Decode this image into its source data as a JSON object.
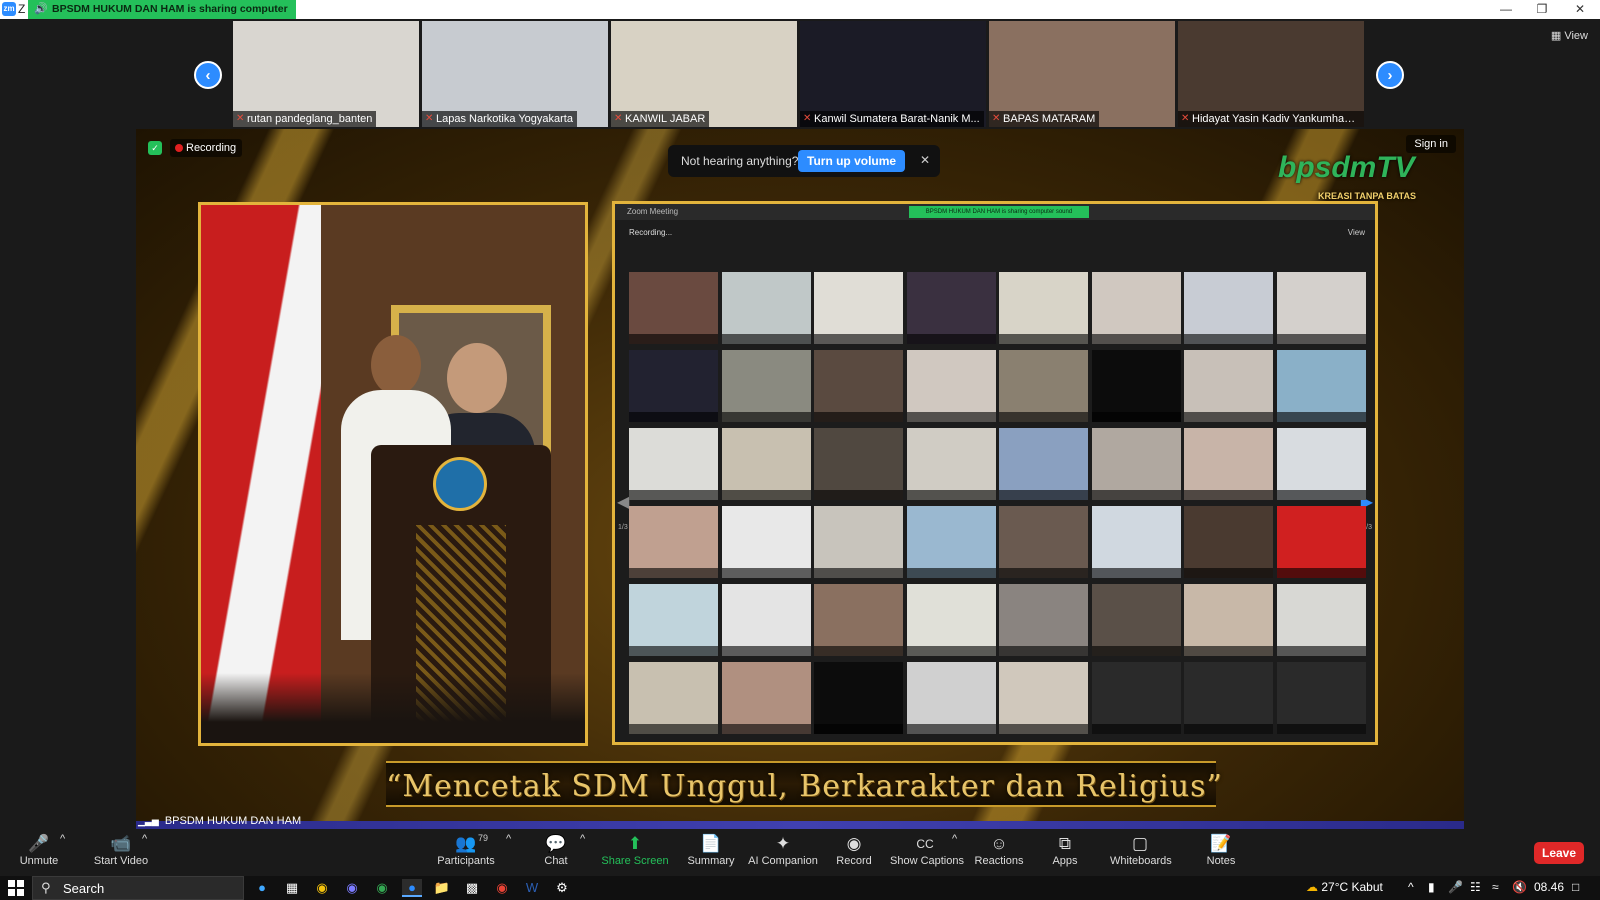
{
  "app": {
    "title_letter": "Z",
    "share_banner": "BPSDM HUKUM DAN HAM is sharing computer sound",
    "view_label": "View"
  },
  "gallery": [
    {
      "name": "rutan pandeglang_banten",
      "bg": "#d9d6d0"
    },
    {
      "name": "Lapas Narkotika Yogyakarta",
      "bg": "#c7cbd0"
    },
    {
      "name": "KANWIL JABAR",
      "bg": "#d8d2c4"
    },
    {
      "name": "Kanwil Sumatera Barat-Nanik M...",
      "bg": "#1b1b26"
    },
    {
      "name": "BAPAS MATARAM",
      "bg": "#8a7060"
    },
    {
      "name": "Hidayat Yasin Kadiv Yankumham ...",
      "bg": "#4a3a30"
    }
  ],
  "share": {
    "recording_label": "Recording",
    "sign_in": "Sign in",
    "toast_msg": "Not hearing anything?",
    "toast_btn": "Turn up volume",
    "logo_text": "bpsdmTV",
    "logo_sub": "KREASI TANPA BATAS",
    "slogan": "“Mencetak SDM Unggul, Berkarakter dan Religius”",
    "presenter_name": "BPSDM HUKUM DAN HAM",
    "nested_title": "Zoom Meeting",
    "nested_banner": "BPSDM HUKUM DAN HAM is sharing computer sound",
    "nested_rec": "Recording...",
    "nested_view": "View",
    "nested_page_left": "1/3",
    "nested_page_right": "1/3",
    "nested_cells": [
      "#6a4a40",
      "#c0c8c8",
      "#e0ddd6",
      "#3a3040",
      "#d8d4c8",
      "#d0c8c0",
      "#c8ccd4",
      "#d4d0cc",
      "#222230",
      "#8a8a80",
      "#5a4a40",
      "#d0c8c0",
      "#8a8070",
      "#0c0c0c",
      "#c8c0b8",
      "#8ab0c8",
      "#dcdcd8",
      "#c8c0b0",
      "#504840",
      "#d0ccc4",
      "#8aa0c0",
      "#b0a8a0",
      "#c8b4a8",
      "#d8dce0",
      "#c0a090",
      "#e8e8e8",
      "#c8c4bc",
      "#9ab8d0",
      "#6a5a50",
      "#d0d8e0",
      "#4a3a30",
      "#d02020",
      "#c0d4dc",
      "#e4e4e4",
      "#8a7060",
      "#e0e0d8",
      "#8a8480",
      "#5a5048",
      "#c8b8a8",
      "#d8d8d4",
      "#c8c0b0",
      "#b09080",
      "#0c0c0c",
      "#d0d0d0",
      "#d0c8bc",
      "#2a2a2a",
      "#2a2a2a",
      "#2a2a2a"
    ]
  },
  "controls": {
    "unmute": "Unmute",
    "start_video": "Start Video",
    "participants": "Participants",
    "participants_count": "79",
    "chat": "Chat",
    "share_screen": "Share Screen",
    "summary": "Summary",
    "ai_companion": "AI Companion",
    "record": "Record",
    "show_captions": "Show Captions",
    "reactions": "Reactions",
    "apps": "Apps",
    "whiteboards": "Whiteboards",
    "notes": "Notes",
    "leave": "Leave"
  },
  "taskbar": {
    "search_placeholder": "Search",
    "weather": "27°C  Kabut",
    "time": "08.46"
  }
}
